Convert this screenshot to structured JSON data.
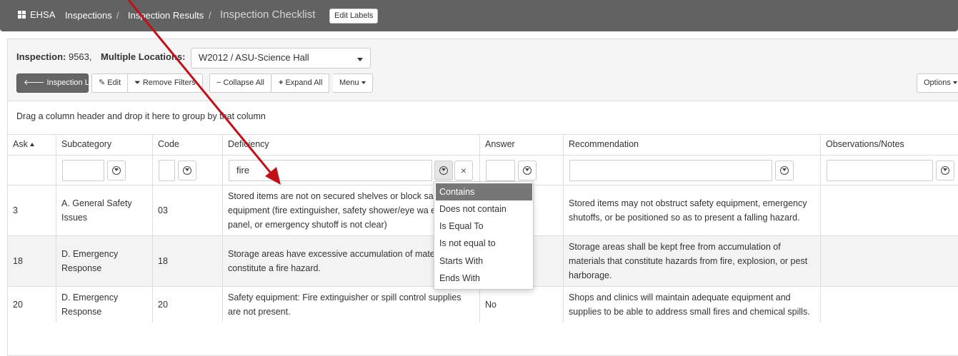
{
  "topbar": {
    "brand": "EHSA",
    "crumbs": [
      "Inspections",
      "Inspection Results"
    ],
    "current": "Inspection Checklist",
    "edit_labels": "Edit Labels"
  },
  "inspection": {
    "label": "Inspection:",
    "id": "9563,",
    "locations_label": "Multiple Locations:",
    "location_value": "W2012 / ASU-Science Hall"
  },
  "toolbar": {
    "inspection_list": "Inspection List",
    "edit": "Edit",
    "remove_filters": "Remove Filters",
    "collapse_all": "Collapse All",
    "expand_all": "Expand All",
    "menu": "Menu",
    "options": "Options"
  },
  "group_hint": "Drag a column header and drop it here to group by that column",
  "columns": {
    "ask": "Ask",
    "subcategory": "Subcategory",
    "code": "Code",
    "deficiency": "Deficiency",
    "answer": "Answer",
    "recommendation": "Recommendation",
    "notes": "Observations/Notes"
  },
  "filters": {
    "deficiency_value": "fire",
    "clear": "×"
  },
  "filter_menu": {
    "options": [
      "Contains",
      "Does not contain",
      "Is Equal To",
      "Is not equal to",
      "Starts With",
      "Ends With"
    ],
    "selected": "Contains"
  },
  "rows": [
    {
      "ask": "3",
      "subcategory": "A. General Safety Issues",
      "code": "03",
      "deficiency": "Stored items are not on secured shelves or block sa equipment (fire extinguisher, safety shower/eye wa electrical panel, or emergency shutoff is not clear)",
      "answer": "",
      "recommendation": "Stored items may not obstruct safety equipment, emergency shutoffs, or be positioned so as to present a falling hazard.",
      "notes": ""
    },
    {
      "ask": "18",
      "subcategory": "D. Emergency Response",
      "code": "18",
      "deficiency": "Storage areas have excessive accumulation of mate constitute a fire hazard.",
      "answer": "",
      "recommendation": "Storage areas shall be kept free from accumulation of materials that constitute hazards from fire, explosion, or pest harborage.",
      "notes": ""
    },
    {
      "ask": "20",
      "subcategory": "D. Emergency Response",
      "code": "20",
      "deficiency": "Safety equipment: Fire extinguisher or spill control supplies are not present.",
      "answer": "No",
      "recommendation": "Shops and clinics will maintain adequate equipment and supplies to be able to address small fires and chemical spills.",
      "notes": ""
    }
  ],
  "colors": {
    "topbar": "#626262",
    "annotation_arrow": "#c0111a",
    "selected_option": "#777777"
  }
}
